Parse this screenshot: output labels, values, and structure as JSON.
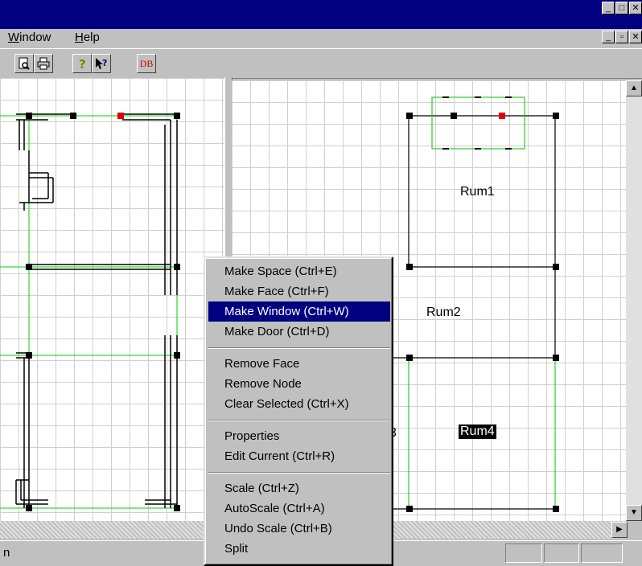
{
  "window": {
    "title_buttons": [
      "_",
      "□",
      "✕"
    ],
    "mdi_buttons": [
      "_",
      "▫",
      "✕"
    ]
  },
  "menubar": {
    "items": [
      {
        "label": "Window",
        "accel": "W",
        "rest": "indow"
      },
      {
        "label": "Help",
        "accel": "H",
        "rest": "elp"
      }
    ]
  },
  "toolbar": {
    "icons": [
      "print-preview-icon",
      "print-icon",
      "help-icon",
      "context-help-icon",
      "db-icon"
    ],
    "db_label": "DB"
  },
  "canvas": {
    "rooms": [
      "Rum1",
      "Rum2",
      "Rum4"
    ],
    "partial_label": "3"
  },
  "context_menu": {
    "items": [
      {
        "label": "Make Space (Ctrl+E)"
      },
      {
        "label": "Make Face (Ctrl+F)"
      },
      {
        "label": "Make Window (Ctrl+W)",
        "selected": true
      },
      {
        "label": "Make Door (Ctrl+D)"
      },
      {
        "label": "Remove Face"
      },
      {
        "label": "Remove Node"
      },
      {
        "label": "Clear Selected (Ctrl+X)"
      },
      {
        "label": "Properties"
      },
      {
        "label": "Edit Current (Ctrl+R)"
      },
      {
        "label": "Scale (Ctrl+Z)"
      },
      {
        "label": "AutoScale (Ctrl+A)"
      },
      {
        "label": "Undo Scale (Ctrl+B)"
      },
      {
        "label": "Split"
      }
    ]
  },
  "statusbar": {
    "text": "n"
  },
  "colors": {
    "titlebar": "#000080",
    "selection": "#000080",
    "grid": "#d0d0d0",
    "face_line": "#00c000",
    "node_selected": "#e00000"
  }
}
